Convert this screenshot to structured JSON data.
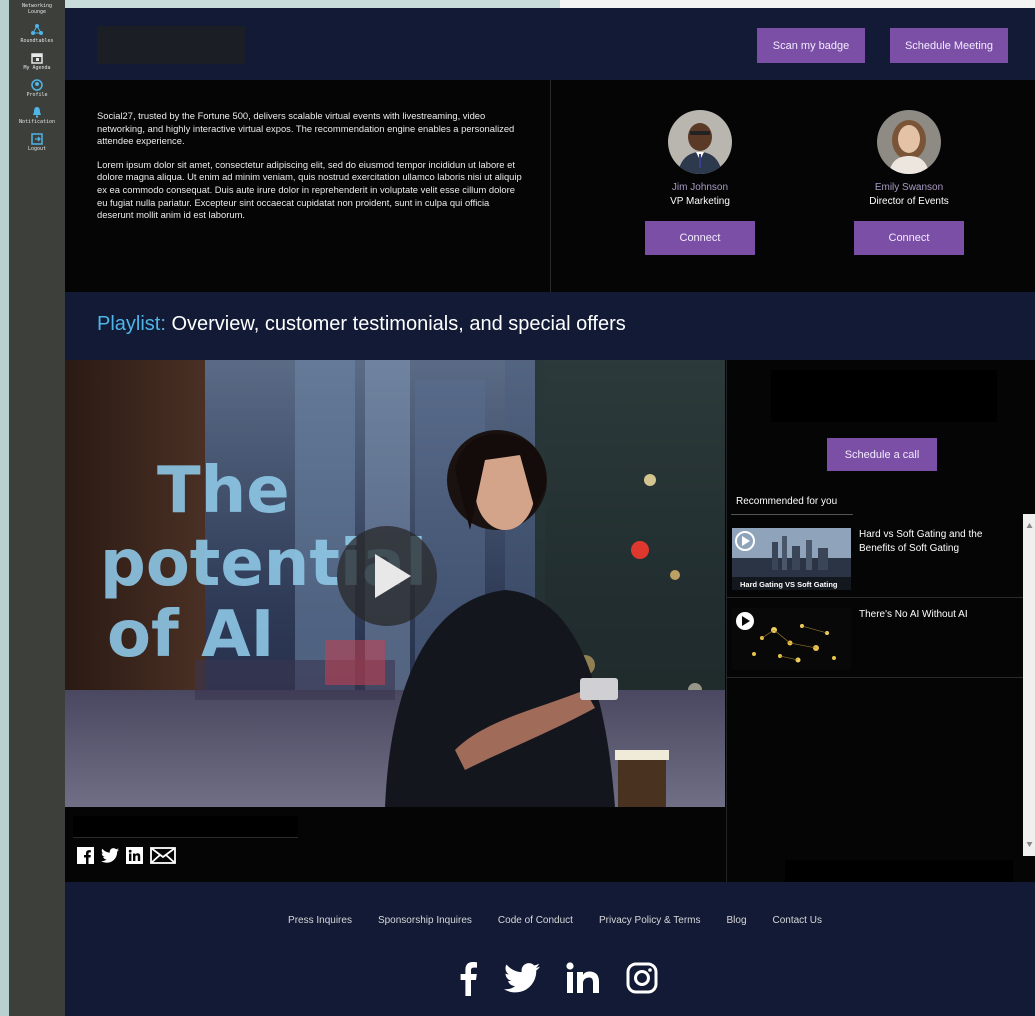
{
  "sidebar": {
    "items": [
      {
        "label": "Networking Lounge",
        "icon": "people-icon"
      },
      {
        "label": "Roundtables",
        "icon": "network-icon"
      },
      {
        "label": "My Agenda",
        "icon": "calendar-icon"
      },
      {
        "label": "Profile",
        "icon": "profile-icon"
      },
      {
        "label": "Notification",
        "icon": "bell-icon"
      },
      {
        "label": "Logout",
        "icon": "logout-icon"
      }
    ]
  },
  "header": {
    "scan_badge_label": "Scan my badge",
    "schedule_meeting_label": "Schedule Meeting"
  },
  "about": {
    "paragraph1": "Social27, trusted by the Fortune 500, delivers scalable virtual  events with livestreaming, video networking, and highly interactive virtual expos. The recommendation engine enables a personalized attendee experience.",
    "paragraph2": "Lorem ipsum dolor sit amet, consectetur adipiscing elit, sed do eiusmod tempor incididun ut labore et dolore magna aliqua. Ut enim ad minim veniam, quis nostrud exercitation ullamco laboris nisi ut aliquip ex ea commodo consequat. Duis aute irure dolor in reprehenderit in voluptate velit esse cillum dolore eu fugiat nulla pariatur. Excepteur sint occaecat cupidatat non proident, sunt in culpa qui officia deserunt mollit anim id est laborum."
  },
  "speakers": [
    {
      "name": "Jim Johnson",
      "title": "VP Marketing",
      "connect_label": "Connect"
    },
    {
      "name": "Emily Swanson",
      "title": "Director of Events",
      "connect_label": "Connect"
    }
  ],
  "playlist": {
    "label": "Playlist:",
    "title": "Overview, customer testimonials, and special offers"
  },
  "video": {
    "overlay_line1": "The",
    "overlay_line2": "potential",
    "overlay_line3": "of AI"
  },
  "right_panel": {
    "schedule_call_label": "Schedule a call",
    "recommended_title": "Recommended for you",
    "items": [
      {
        "title": "Hard vs Soft Gating and the Benefits of Soft Gating",
        "thumb_caption": "Hard Gating VS Soft Gating"
      },
      {
        "title": "There's No AI Without AI",
        "thumb_caption": ""
      }
    ]
  },
  "footer": {
    "links": [
      "Press Inquires",
      "Sponsorship Inquires",
      "Code of Conduct",
      "Privacy Policy & Terms",
      "Blog",
      "Contact Us"
    ]
  },
  "colors": {
    "navy": "#121a36",
    "purple_button": "#7b4fa6",
    "playlist_label": "#4fb4e6",
    "sidebar": "#3c3f3a"
  }
}
